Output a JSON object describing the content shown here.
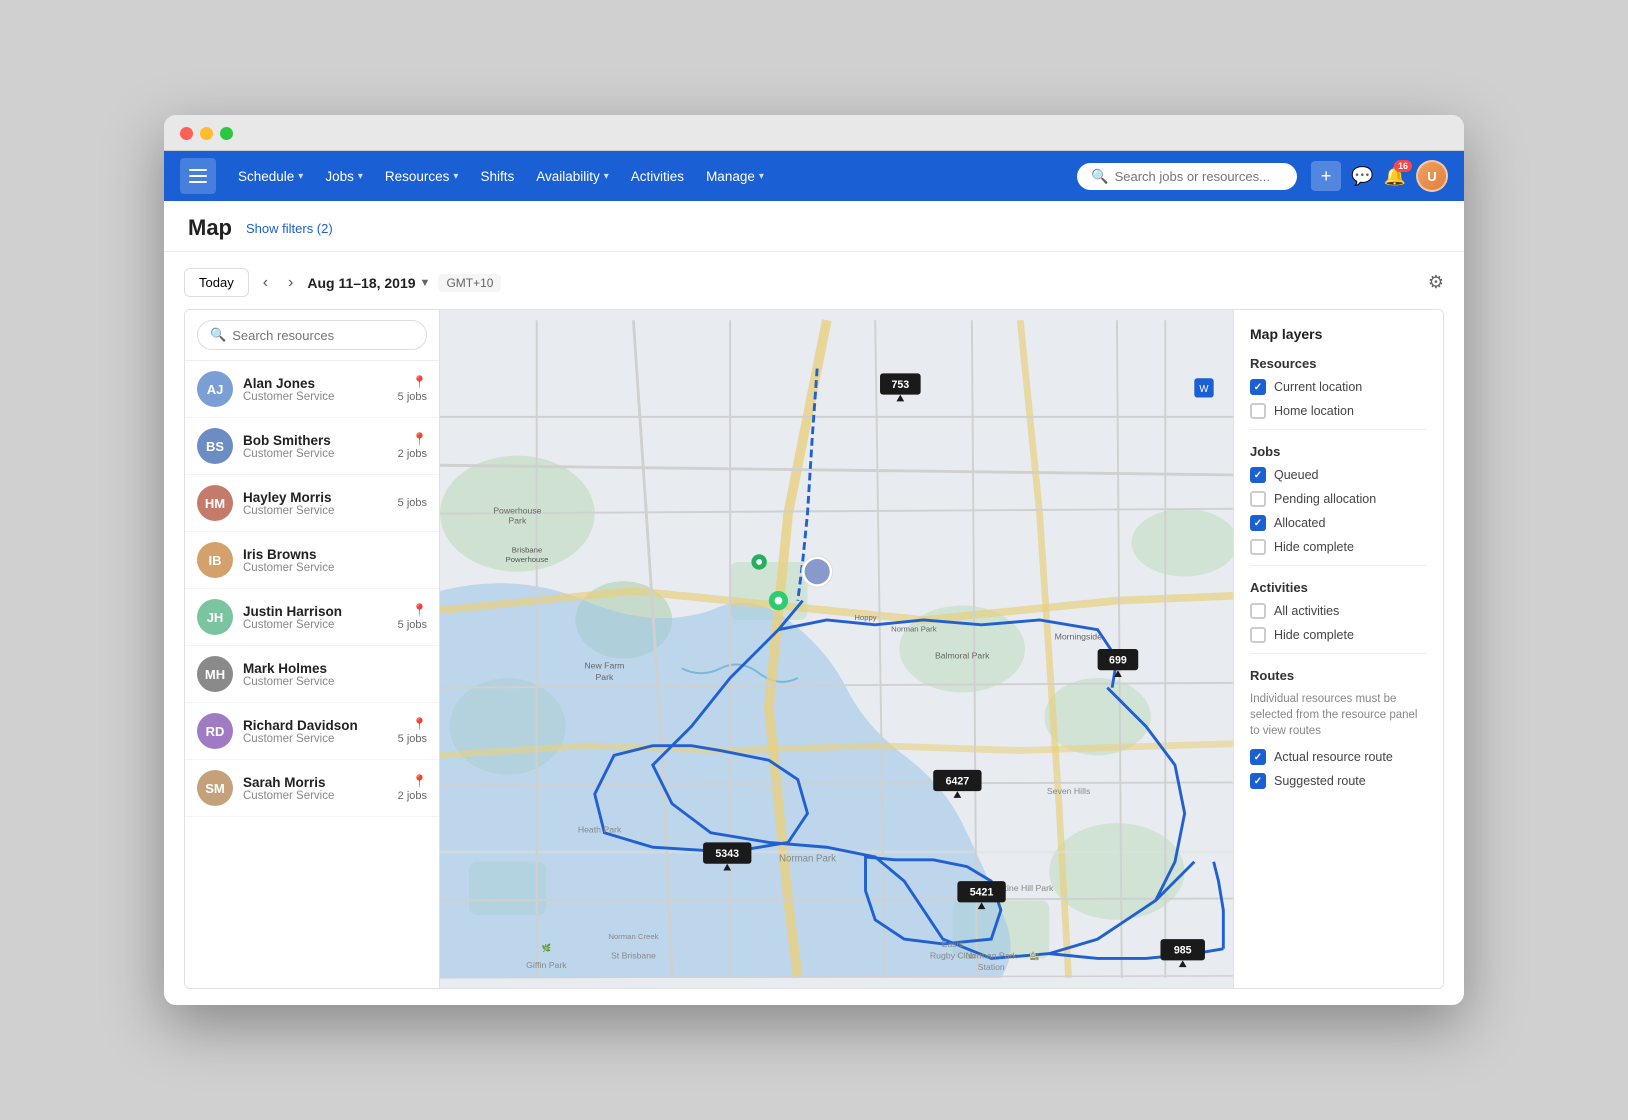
{
  "browser": {
    "dots": [
      "red",
      "yellow",
      "green"
    ]
  },
  "nav": {
    "hamburger_label": "Menu",
    "items": [
      {
        "id": "schedule",
        "label": "Schedule",
        "has_dropdown": true
      },
      {
        "id": "jobs",
        "label": "Jobs",
        "has_dropdown": true
      },
      {
        "id": "resources",
        "label": "Resources",
        "has_dropdown": true
      },
      {
        "id": "shifts",
        "label": "Shifts",
        "has_dropdown": false
      },
      {
        "id": "availability",
        "label": "Availability",
        "has_dropdown": true
      },
      {
        "id": "activities",
        "label": "Activities",
        "has_dropdown": false
      },
      {
        "id": "manage",
        "label": "Manage",
        "has_dropdown": true
      }
    ],
    "search_placeholder": "Search jobs or resources...",
    "add_button_label": "+",
    "notification_count": "16",
    "user_initial": "U"
  },
  "page": {
    "title": "Map",
    "show_filters_label": "Show filters (2)"
  },
  "toolbar": {
    "today_label": "Today",
    "date_range": "Aug 11–18, 2019",
    "gmt": "GMT+10",
    "prev_label": "‹",
    "next_label": "›"
  },
  "resources_panel": {
    "search_placeholder": "Search resources",
    "items": [
      {
        "id": "alan-jones",
        "name": "Alan Jones",
        "role": "Customer Service",
        "jobs": "5 jobs",
        "has_location": true,
        "color": "#7b9ed4",
        "initial": "AJ"
      },
      {
        "id": "bob-smithers",
        "name": "Bob Smithers",
        "role": "Customer Service",
        "jobs": "2 jobs",
        "has_location": true,
        "color": "#6b8dc4",
        "initial": "BS"
      },
      {
        "id": "hayley-morris",
        "name": "Hayley Morris",
        "role": "Customer Service",
        "jobs": "5 jobs",
        "has_location": false,
        "color": "#c47b6b",
        "initial": "HM"
      },
      {
        "id": "iris-browns",
        "name": "Iris Browns",
        "role": "Customer Service",
        "jobs": "",
        "has_location": false,
        "color": "#d4a06b",
        "initial": "IB"
      },
      {
        "id": "justin-harrison",
        "name": "Justin Harrison",
        "role": "Customer Service",
        "jobs": "5 jobs",
        "has_location": true,
        "color": "#7bc4a0",
        "initial": "JH"
      },
      {
        "id": "mark-holmes",
        "name": "Mark Holmes",
        "role": "Customer Service",
        "jobs": "",
        "has_location": false,
        "color": "#8a8a8a",
        "initial": "MH"
      },
      {
        "id": "richard-davidson",
        "name": "Richard Davidson",
        "role": "Customer Service",
        "jobs": "5 jobs",
        "has_location": true,
        "color": "#a07bc4",
        "initial": "RD"
      },
      {
        "id": "sarah-morris",
        "name": "Sarah Morris",
        "role": "Customer Service",
        "jobs": "2 jobs",
        "has_location": true,
        "color": "#c4a07b",
        "initial": "SM"
      }
    ]
  },
  "map_layers": {
    "title": "Map layers",
    "resources_section": "Resources",
    "resources_items": [
      {
        "label": "Current location",
        "checked": true
      },
      {
        "label": "Home location",
        "checked": false
      }
    ],
    "jobs_section": "Jobs",
    "jobs_items": [
      {
        "label": "Queued",
        "checked": true
      },
      {
        "label": "Pending allocation",
        "checked": false
      },
      {
        "label": "Allocated",
        "checked": true
      },
      {
        "label": "Hide complete",
        "checked": false
      }
    ],
    "activities_section": "Activities",
    "activities_items": [
      {
        "label": "All activities",
        "checked": false
      },
      {
        "label": "Hide complete",
        "checked": false
      }
    ],
    "routes_section": "Routes",
    "routes_note": "Individual resources must be selected from the resource panel to view routes",
    "routes_items": [
      {
        "label": "Actual resource route",
        "checked": true
      },
      {
        "label": "Suggested route",
        "checked": true
      }
    ]
  },
  "map_markers": [
    {
      "id": "753",
      "label": "753"
    },
    {
      "id": "699",
      "label": "699"
    },
    {
      "id": "6427",
      "label": "6427"
    },
    {
      "id": "5343",
      "label": "5343"
    },
    {
      "id": "5421",
      "label": "5421"
    },
    {
      "id": "985",
      "label": "985"
    }
  ]
}
